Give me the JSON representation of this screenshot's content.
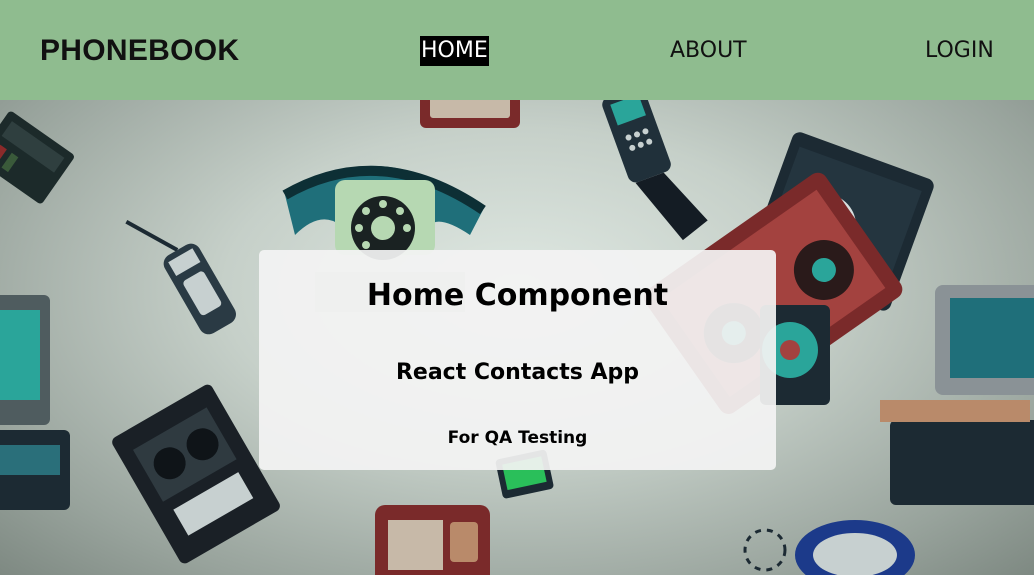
{
  "nav": {
    "brand": "PHONEBOOK",
    "links": [
      "HOME",
      "ABOUT",
      "LOGIN"
    ],
    "active": "HOME"
  },
  "home": {
    "title": "Home Component",
    "subtitle": "React Contacts App",
    "note": "For QA Testing"
  },
  "colors": {
    "navbar": "#8fbc8f",
    "active_link_bg": "#000000",
    "card_bg": "#f3f3f3"
  }
}
